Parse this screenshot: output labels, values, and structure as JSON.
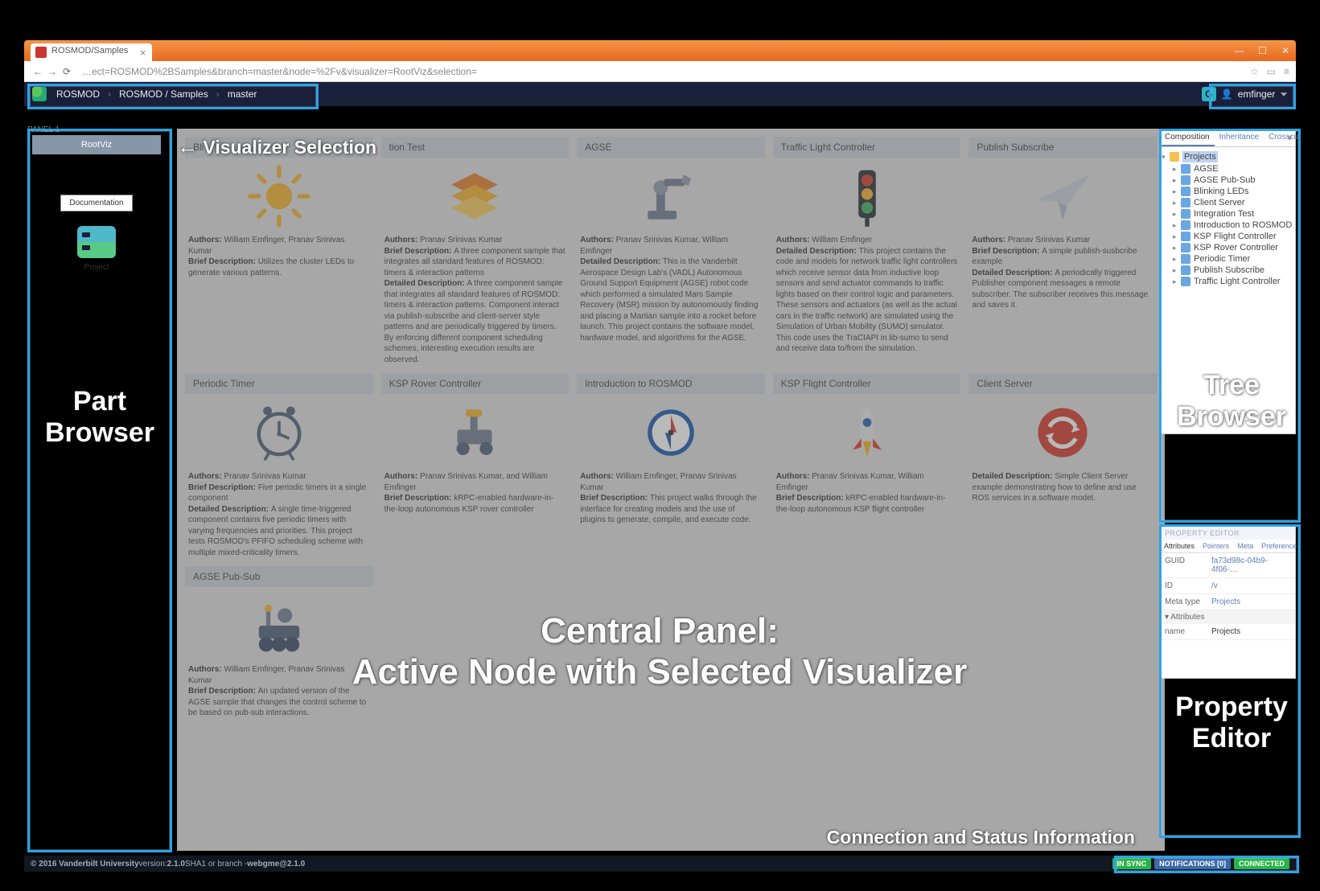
{
  "browser": {
    "tab_title": "ROSMOD/Samples",
    "url": "…ect=ROSMOD%2BSamples&branch=master&node=%2Fv&visualizer=RootViz&selection="
  },
  "breadcrumb": {
    "items": [
      "ROSMOD",
      "ROSMOD / Samples",
      "master"
    ],
    "user": "emfinger",
    "user_initial": "G"
  },
  "left": {
    "panel_label": "PANEL 1",
    "viz_tab": "RootViz",
    "doc_button": "Documentation",
    "project_label": "Project"
  },
  "cards": [
    {
      "title": "Bli",
      "authors": "William Emfinger, Pranav Srinivas Kumar",
      "brief": "Utilizes the cluster LEDs to generate various patterns."
    },
    {
      "title": "tion Test",
      "authors": "Pranav Srinivas Kumar",
      "brief": "A three component sample that integrates all standard features of ROSMOD: timers & interaction patterns",
      "detailed": "A three component sample that integrates all standard features of ROSMOD: timers & interaction patterns. Component interact via publish-subscribe and client-server style patterns and are periodically triggered by timers. By enforcing different component scheduling schemes, interesting execution results are observed."
    },
    {
      "title": "AGSE",
      "authors": "Pranav Srinivas Kumar, William Emfinger",
      "detailed": "This is the Vanderbilt Aerospace Design Lab's (VADL) Autonomous Ground Support Equipment (AGSE) robot code which performed a simulated Mars Sample Recovery (MSR) mission by autonomously finding and placing a Martian sample into a rocket before launch. This project contains the software model, hardware model, and algorithms for the AGSE."
    },
    {
      "title": "Traffic Light Controller",
      "authors": "William Emfinger",
      "detailed": "This project contains the code and models for network traffic light controllers which receive sensor data from inductive loop sensors and send actuator commands to traffic lights based on their control logic and parameters. These sensors and actuators (as well as the actual cars in the traffic network) are simulated using the Simulation of Urban Mobility (SUMO) simulator. This code uses the TraCIAPI in lib-sumo to send and receive data to/from the simulation."
    },
    {
      "title": "Publish Subscribe",
      "authors": "Pranav Srinivas Kumar",
      "brief": "A simple publish-susbcribe example",
      "detailed": "A periodically triggered Publisher component messages a remote subscriber. The subscriber receives this message and saves it."
    },
    {
      "title": "Periodic Timer",
      "authors": "Pranav Srinivas Kumar",
      "brief": "Five periodic timers in a single component",
      "detailed": "A single time-triggered component contains five periodic timers with varying frequencies and priorities. This project tests ROSMOD's PFIFO scheduling scheme with multiple mixed-criticality timers."
    },
    {
      "title": "KSP Rover Controller",
      "authors": "Pranav Srinivas Kumar, and William Emfinger",
      "brief": "kRPC-enabled hardware-in-the-loop autonomous KSP rover controller"
    },
    {
      "title": "Introduction to ROSMOD",
      "authors": "William Emfinger, Pranav Srinivas Kumar",
      "brief": "This project walks through the interface for creating models and the use of plugins to generate, compile, and execute code."
    },
    {
      "title": "KSP Flight Controller",
      "authors": "Pranav Srinivas Kumar, William Emfinger",
      "brief": "kRPC-enabled hardware-in-the-loop autonomous KSP flight controller"
    },
    {
      "title": "Client Server",
      "detailed": "Simple Client Server example demonstrating how to define and use ROS services in a software model."
    },
    {
      "title": "AGSE Pub-Sub",
      "authors": "William Emfinger, Pranav Srinivas Kumar",
      "brief": "An updated version of the AGSE sample that changes the control scheme to be based on pub-sub interactions."
    }
  ],
  "tree": {
    "tabs": [
      "Composition",
      "Inheritance",
      "Crosscut"
    ],
    "root": "Projects",
    "items": [
      "AGSE",
      "AGSE Pub-Sub",
      "Blinking LEDs",
      "Client Server",
      "Integration Test",
      "Introduction to ROSMOD",
      "KSP Flight Controller",
      "KSP Rover Controller",
      "Periodic Timer",
      "Publish Subscribe",
      "Traffic Light Controller"
    ]
  },
  "property_editor": {
    "title": "PROPERTY EDITOR",
    "tabs": [
      "Attributes",
      "Pointers",
      "Meta",
      "Preference"
    ],
    "guid": "fa73d98c-04b9-4f06-…",
    "id": "/v",
    "meta_type": "Projects",
    "section": "Attributes",
    "name_key": "name",
    "name_val": "Projects"
  },
  "status": {
    "copyright": "© 2016 Vanderbilt University",
    "version_label": " version: ",
    "version": "2.1.0",
    "sha_label": " SHA1 or branch - ",
    "sha": "webgme@2.1.0",
    "pills": [
      "IN SYNC",
      "NOTIFICATIONS [0]",
      "CONNECTED"
    ]
  },
  "annotations": {
    "viz": "Visualizer Selection",
    "part": "Part Browser",
    "tree": "Tree Browser",
    "prop": "Property Editor",
    "central1": "Central Panel:",
    "central2": "Active Node with Selected Visualizer",
    "conn": "Connection and Status Information"
  },
  "labels": {
    "authors": "Authors: ",
    "brief": "Brief Description: ",
    "detailed": "Detailed Description: ",
    "guid": "GUID",
    "id": "ID",
    "meta": "Meta type"
  }
}
